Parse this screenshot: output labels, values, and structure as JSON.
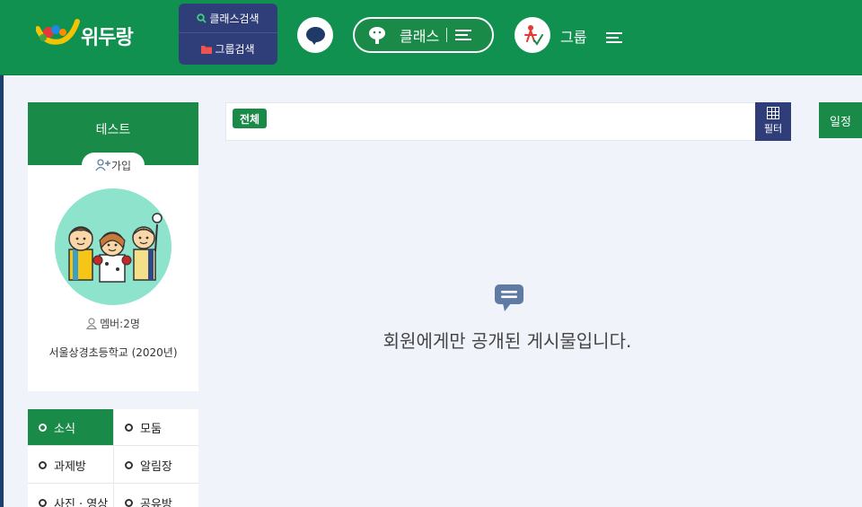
{
  "header": {
    "logo_text": "위두랑",
    "class_search_label": "클래스검색",
    "group_search_label": "그룹검색",
    "class_label": "클래스",
    "group_label": "그룹"
  },
  "class_card": {
    "title": "테스트",
    "join_label": "가입",
    "member_count": "멤버:2명",
    "school": "서울상경초등학교 (2020년)"
  },
  "board_menu": {
    "items": [
      {
        "label": "소식",
        "active": true
      },
      {
        "label": "모둠",
        "active": false
      },
      {
        "label": "과제방",
        "active": false
      },
      {
        "label": "알림장",
        "active": false
      },
      {
        "label": "사진 · 영상",
        "active": false
      },
      {
        "label": "공유방",
        "active": false
      }
    ]
  },
  "filter": {
    "all_tag": "전체",
    "filter_label": "필터"
  },
  "schedule_tab": "일정",
  "empty_state": {
    "message": "회원에게만 공개된 게시물입니다."
  },
  "colors": {
    "primary_green": "#109150",
    "navy": "#2f3e78",
    "page_bg": "#f0f4fa"
  }
}
